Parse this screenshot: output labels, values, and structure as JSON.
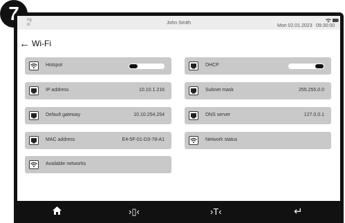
{
  "step_badge": "7",
  "status": {
    "left_line1": "ng",
    "left_line2": "in",
    "user": "John Smith",
    "date": "Mon 02.01.2023",
    "time": "09:30:00",
    "icons": [
      "wifi-icon",
      "battery-icon"
    ]
  },
  "page": {
    "back_icon": "arrow-left-icon",
    "title": "Wi-Fi"
  },
  "tiles": {
    "hotspot": {
      "label": "Hotspot",
      "icon": "wifi-icon",
      "toggle": "off"
    },
    "dhcp": {
      "label": "DHCP",
      "icon": "network-port-icon",
      "toggle": "on"
    },
    "ip": {
      "label": "IP address",
      "value": "10.10.1.216",
      "icon": "network-port-icon"
    },
    "subnet": {
      "label": "Subnet mask",
      "value": "255.255.0.0",
      "icon": "network-port-icon"
    },
    "gateway": {
      "label": "Default gateway",
      "value": "10.10.254.254",
      "icon": "network-port-icon"
    },
    "dns": {
      "label": "DNS server",
      "value": "127.0.0.1",
      "icon": "network-port-icon"
    },
    "mac": {
      "label": "MAC address",
      "value": "E4-5F-01-D3-78-A1",
      "icon": "network-port-icon"
    },
    "netstatus": {
      "label": "Network status",
      "icon": "wifi-icon"
    },
    "available": {
      "label": "Available networks",
      "icon": "wifi-icon"
    }
  },
  "navbar": {
    "home": "home-icon",
    "nav2": "›▯‹",
    "nav3": "›T‹",
    "enter": "↵"
  }
}
